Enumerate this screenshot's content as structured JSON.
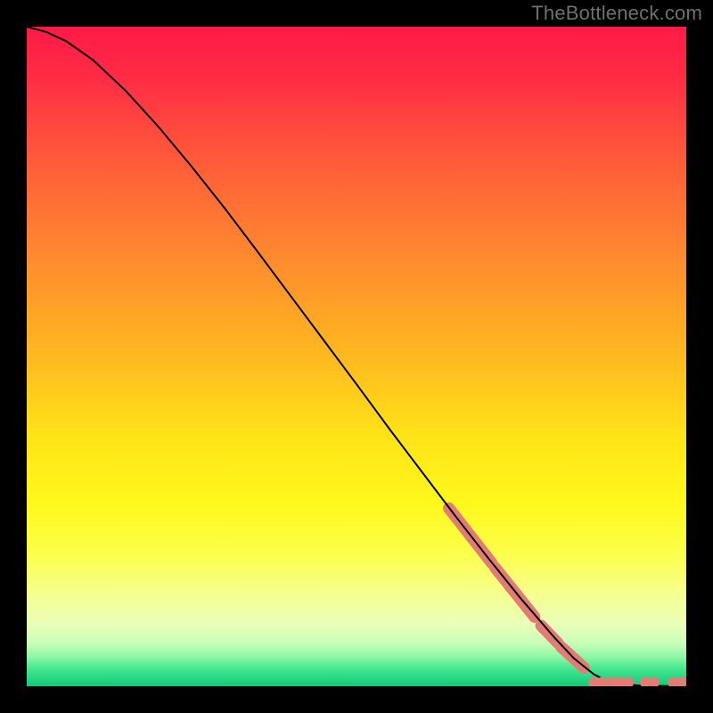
{
  "watermark": "TheBottleneck.com",
  "chart_data": {
    "type": "line",
    "title": "",
    "xlabel": "",
    "ylabel": "",
    "xlim": [
      0,
      100
    ],
    "ylim": [
      0,
      100
    ],
    "gradient_stops": [
      {
        "offset": 0.0,
        "color": "#ff1a47"
      },
      {
        "offset": 0.08,
        "color": "#ff2d44"
      },
      {
        "offset": 0.2,
        "color": "#ff5a3a"
      },
      {
        "offset": 0.35,
        "color": "#ff8a2e"
      },
      {
        "offset": 0.5,
        "color": "#ffb91f"
      },
      {
        "offset": 0.62,
        "color": "#ffe318"
      },
      {
        "offset": 0.72,
        "color": "#fff81a"
      },
      {
        "offset": 0.8,
        "color": "#fcff4c"
      },
      {
        "offset": 0.86,
        "color": "#f5ff8f"
      },
      {
        "offset": 0.905,
        "color": "#eaffb8"
      },
      {
        "offset": 0.935,
        "color": "#c8ffb8"
      },
      {
        "offset": 0.955,
        "color": "#8ef7a8"
      },
      {
        "offset": 0.975,
        "color": "#3fe58d"
      },
      {
        "offset": 1.0,
        "color": "#12c97a"
      }
    ],
    "curve": [
      {
        "x": 0,
        "y": 100
      },
      {
        "x": 3,
        "y": 99.2
      },
      {
        "x": 6,
        "y": 97.8
      },
      {
        "x": 10,
        "y": 95.0
      },
      {
        "x": 15,
        "y": 90.3
      },
      {
        "x": 20,
        "y": 84.8
      },
      {
        "x": 25,
        "y": 78.8
      },
      {
        "x": 30,
        "y": 72.5
      },
      {
        "x": 35,
        "y": 65.9
      },
      {
        "x": 40,
        "y": 59.2
      },
      {
        "x": 45,
        "y": 52.5
      },
      {
        "x": 50,
        "y": 45.8
      },
      {
        "x": 55,
        "y": 39.0
      },
      {
        "x": 60,
        "y": 32.4
      },
      {
        "x": 65,
        "y": 25.8
      },
      {
        "x": 70,
        "y": 19.4
      },
      {
        "x": 75,
        "y": 13.2
      },
      {
        "x": 80,
        "y": 7.4
      },
      {
        "x": 83,
        "y": 4.2
      },
      {
        "x": 86,
        "y": 1.8
      },
      {
        "x": 88,
        "y": 0.8
      },
      {
        "x": 90,
        "y": 0.3
      },
      {
        "x": 93,
        "y": 0.1
      },
      {
        "x": 96,
        "y": 0.05
      },
      {
        "x": 100,
        "y": 0.0
      }
    ],
    "highlight_segments": [
      {
        "x1": 64.0,
        "y1": 27.0,
        "x2": 70.5,
        "y2": 18.7
      },
      {
        "x1": 71.0,
        "y1": 18.0,
        "x2": 77.0,
        "y2": 10.5
      },
      {
        "x1": 78.0,
        "y1": 9.2,
        "x2": 80.5,
        "y2": 6.6
      },
      {
        "x1": 81.0,
        "y1": 6.0,
        "x2": 84.5,
        "y2": 2.8
      }
    ],
    "highlight_points": [
      {
        "x": 86.0,
        "y": 0.6
      },
      {
        "x": 87.3,
        "y": 0.6
      },
      {
        "x": 88.7,
        "y": 0.6
      },
      {
        "x": 89.9,
        "y": 0.6
      },
      {
        "x": 91.2,
        "y": 0.6
      },
      {
        "x": 93.8,
        "y": 0.6
      },
      {
        "x": 95.1,
        "y": 0.6
      },
      {
        "x": 98.0,
        "y": 0.6
      },
      {
        "x": 99.3,
        "y": 0.6
      }
    ],
    "style": {
      "curve_stroke": "#000000",
      "curve_width": 2.0,
      "marker_fill": "#e47c76",
      "marker_radius_small": 6.2,
      "marker_radius_seg_half_thickness": 6.6
    }
  }
}
